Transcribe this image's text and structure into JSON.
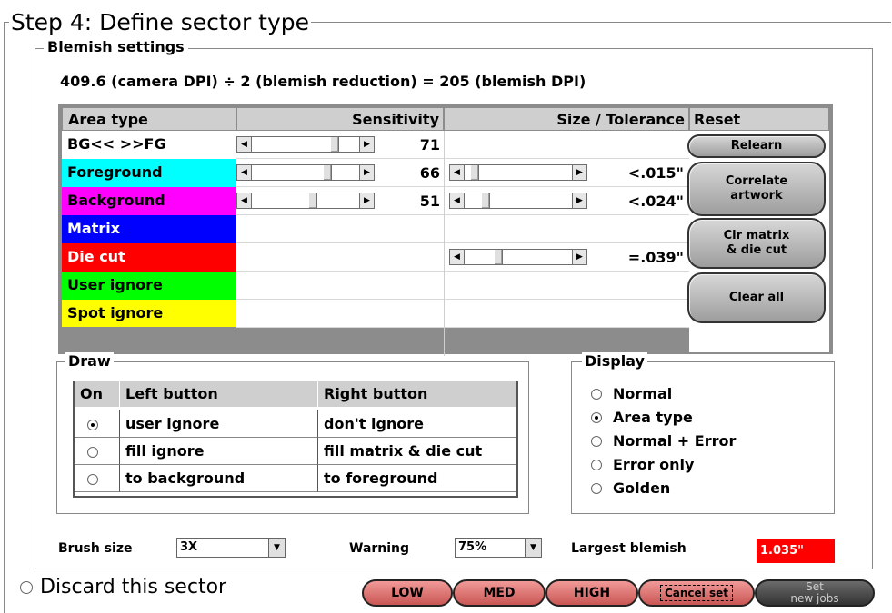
{
  "step": {
    "title": "Step 4: Define sector type"
  },
  "blemish": {
    "title": "Blemish settings",
    "dpi_line": "409.6 (camera DPI) ÷ 2 (blemish reduction) = 205 (blemish DPI)",
    "headers": {
      "area_type": "Area type",
      "sensitivity": "Sensitivity",
      "size_tolerance": "Size / Tolerance",
      "reset": "Reset"
    },
    "rows": [
      {
        "label": "BG<< >>FG",
        "color": "#ffffff",
        "sensitivity": "71",
        "tolerance": ""
      },
      {
        "label": "Foreground",
        "color": "#00ffff",
        "sensitivity": "66",
        "tolerance": "<.015\""
      },
      {
        "label": "Background",
        "color": "#ff00ff",
        "sensitivity": "51",
        "tolerance": "<.024\""
      },
      {
        "label": "Matrix",
        "color": "#0000ff",
        "sensitivity": "",
        "tolerance": ""
      },
      {
        "label": "Die cut",
        "color": "#ff0000",
        "sensitivity": "",
        "tolerance": "=.039\""
      },
      {
        "label": "User ignore",
        "color": "#00ff00",
        "sensitivity": "",
        "tolerance": ""
      },
      {
        "label": "Spot ignore",
        "color": "#ffff00",
        "sensitivity": "",
        "tolerance": ""
      }
    ],
    "reset_buttons": {
      "relearn": "Relearn",
      "correlate_1": "Correlate",
      "correlate_2": "artwork",
      "clr_matrix_1": "Clr matrix",
      "clr_matrix_2": "& die cut",
      "clear_all": "Clear all"
    }
  },
  "draw": {
    "title": "Draw",
    "headers": {
      "on": "On",
      "left": "Left button",
      "right": "Right button"
    },
    "rows": [
      {
        "left": "user ignore",
        "right": "don't ignore",
        "selected": true
      },
      {
        "left": "fill ignore",
        "right": "fill matrix & die cut",
        "selected": false
      },
      {
        "left": "to background",
        "right": "to foreground",
        "selected": false
      }
    ]
  },
  "display": {
    "title": "Display",
    "options": [
      "Normal",
      "Area type",
      "Normal + Error",
      "Error only",
      "Golden"
    ],
    "selected_index": 1
  },
  "bottom": {
    "brush_label": "Brush size",
    "brush_value": "3X",
    "warning_label": "Warning",
    "warning_value": "75%",
    "largest_label": "Largest blemish",
    "largest_value": "1.035\""
  },
  "discard": {
    "label": "Discard this sector"
  },
  "actions": {
    "low": "LOW",
    "med": "MED",
    "high": "HIGH",
    "cancel": "Cancel set",
    "set_1": "Set",
    "set_2": "new jobs"
  },
  "colors": {
    "accent_red": "#ff0000",
    "pill_pink": "#e27c7a",
    "pill_dark": "#4a4a4a"
  }
}
